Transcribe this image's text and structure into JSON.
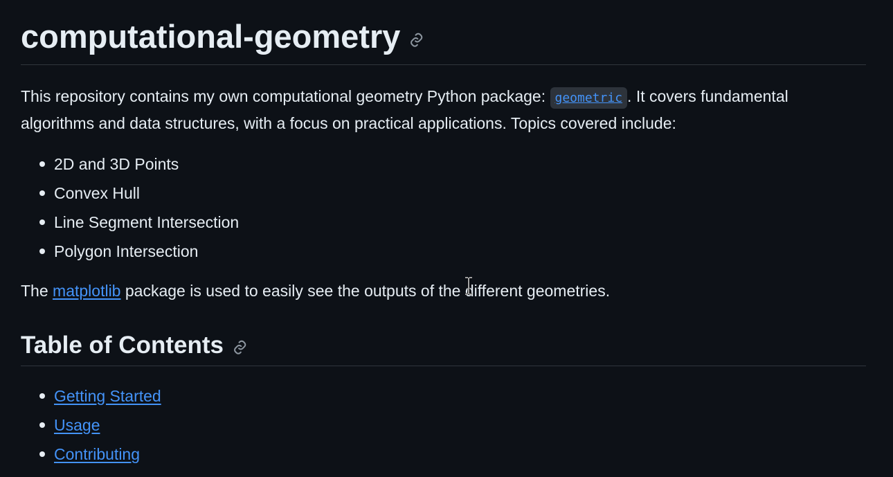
{
  "repo": {
    "title": "computational-geometry",
    "intro_before_code": "This repository contains my own computational geometry Python package: ",
    "package_name": "geometric",
    "intro_after_code": ". It covers fundamental algorithms and data structures, with a focus on practical applications. Topics covered include:",
    "topics": [
      "2D and 3D Points",
      "Convex Hull",
      "Line Segment Intersection",
      "Polygon Intersection"
    ],
    "outro_before_link": "The ",
    "outro_link": "matplotlib",
    "outro_after_link": " package is used to easily see the outputs of the different geometries."
  },
  "toc": {
    "heading": "Table of Contents",
    "items": [
      "Getting Started",
      "Usage",
      "Contributing"
    ]
  },
  "colors": {
    "background": "#0d1117",
    "text": "#e6edf3",
    "link": "#4493f8",
    "divider": "#30363d"
  },
  "icons": {
    "heading_anchor": "link-icon",
    "cursor": "text-cursor-icon"
  }
}
